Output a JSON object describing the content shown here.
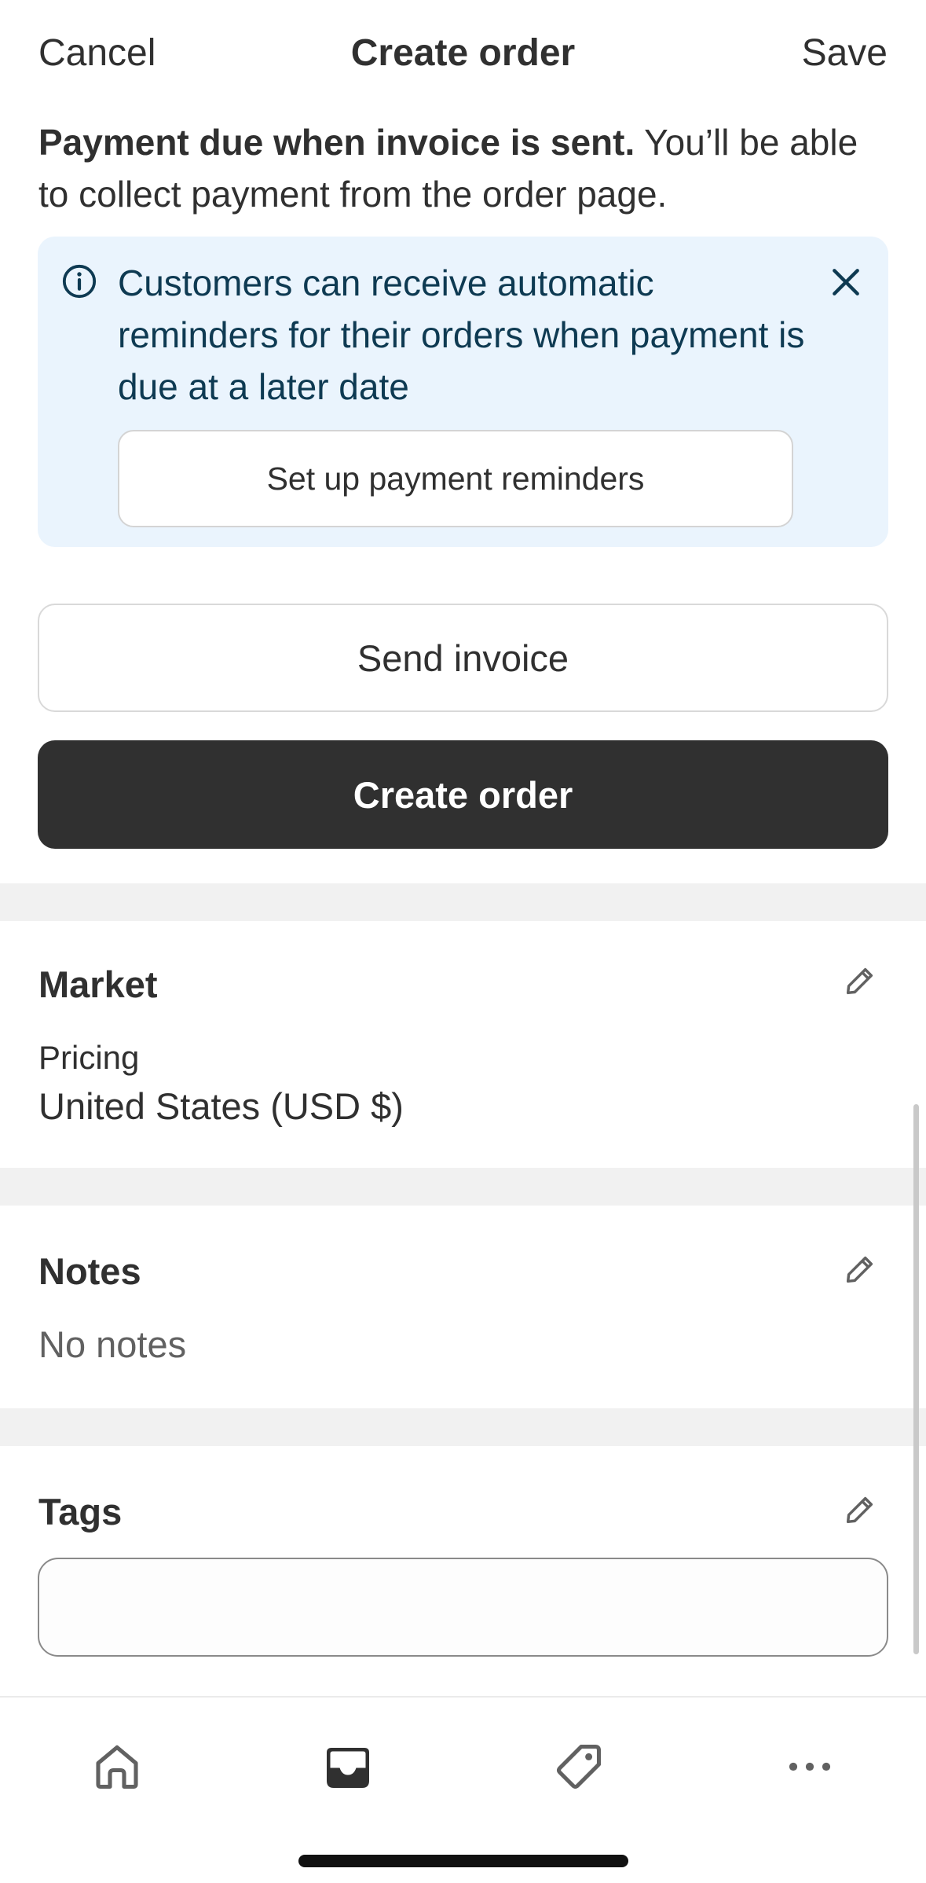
{
  "header": {
    "cancel_label": "Cancel",
    "title": "Create order",
    "save_label": "Save"
  },
  "payment": {
    "bold": "Payment due when invoice is sent.",
    "rest": " You’ll be able to collect payment from the order page."
  },
  "banner": {
    "text": "Customers can receive automatic reminders for their orders when payment is due at a later date",
    "button_label": "Set up payment reminders",
    "icon": "info-icon",
    "close_icon": "close-icon"
  },
  "actions": {
    "send_invoice_label": "Send invoice",
    "create_order_label": "Create order"
  },
  "market": {
    "title": "Market",
    "pricing_label": "Pricing",
    "pricing_value": "United States (USD $)"
  },
  "notes": {
    "title": "Notes",
    "value": "No notes"
  },
  "tags": {
    "title": "Tags",
    "value": ""
  },
  "nav": {
    "items": [
      "home-icon",
      "orders-icon",
      "products-tag-icon",
      "more-icon"
    ],
    "active": "orders-icon"
  },
  "colors": {
    "banner_bg": "#eaf4fd",
    "banner_text": "#0e3a52",
    "primary_button": "#303030",
    "separator": "#f1f1f1"
  }
}
